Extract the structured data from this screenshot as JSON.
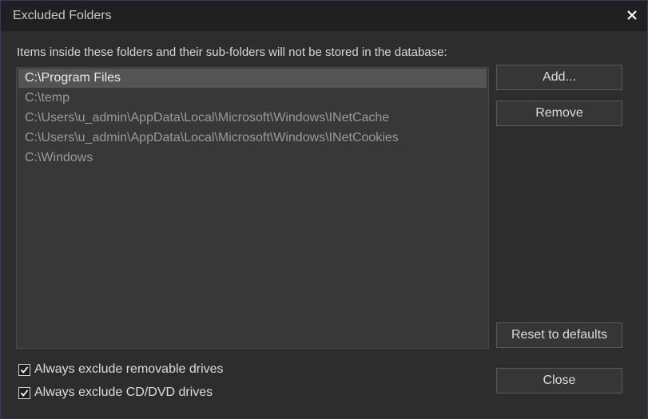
{
  "window": {
    "title": "Excluded Folders",
    "close_icon": "close-icon"
  },
  "description": "Items inside these folders and their sub-folders will not be stored in the database:",
  "folders": [
    {
      "path": "C:\\Program Files",
      "selected": true
    },
    {
      "path": "C:\\temp",
      "selected": false
    },
    {
      "path": "C:\\Users\\u_admin\\AppData\\Local\\Microsoft\\Windows\\INetCache",
      "selected": false
    },
    {
      "path": "C:\\Users\\u_admin\\AppData\\Local\\Microsoft\\Windows\\INetCookies",
      "selected": false
    },
    {
      "path": "C:\\Windows",
      "selected": false
    }
  ],
  "buttons": {
    "add": "Add...",
    "remove": "Remove",
    "reset": "Reset to defaults",
    "close": "Close"
  },
  "options": {
    "removable": {
      "label": "Always exclude removable drives",
      "checked": true
    },
    "cddvd": {
      "label": "Always exclude CD/DVD drives",
      "checked": true
    }
  },
  "colors": {
    "background": "#2d2d2d",
    "titlebar": "#202020",
    "list_background": "#383838",
    "selected_row": "#545454"
  }
}
